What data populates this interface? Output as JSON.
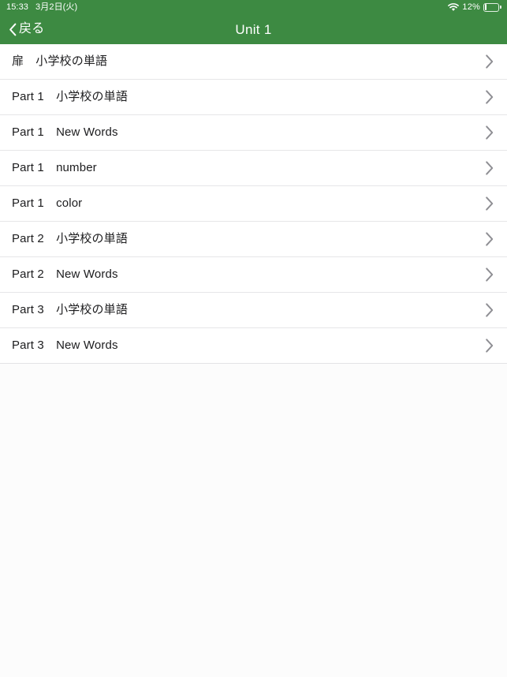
{
  "status_bar": {
    "time": "15:33",
    "date": "3月2日(火)",
    "wifi_icon": "wifi-icon",
    "battery_percent": "12%",
    "battery_icon": "battery-icon",
    "battery_level": 12,
    "background_color": "#3d8a42",
    "text_color": "#ffffff"
  },
  "nav_bar": {
    "back_label": "戻る",
    "back_icon": "chevron-left-icon",
    "title": "Unit 1",
    "background_color": "#3d8a42",
    "text_color": "#ffffff"
  },
  "list": {
    "disclosure_icon": "chevron-right-icon",
    "rows": [
      {
        "label": "扉　小学校の単語"
      },
      {
        "label": "Part 1　小学校の単語"
      },
      {
        "label": "Part 1　New Words"
      },
      {
        "label": "Part 1　number"
      },
      {
        "label": "Part 1　color"
      },
      {
        "label": "Part 2　小学校の単語"
      },
      {
        "label": "Part 2　New Words"
      },
      {
        "label": "Part 3　小学校の単語"
      },
      {
        "label": "Part 3　New Words"
      }
    ]
  }
}
